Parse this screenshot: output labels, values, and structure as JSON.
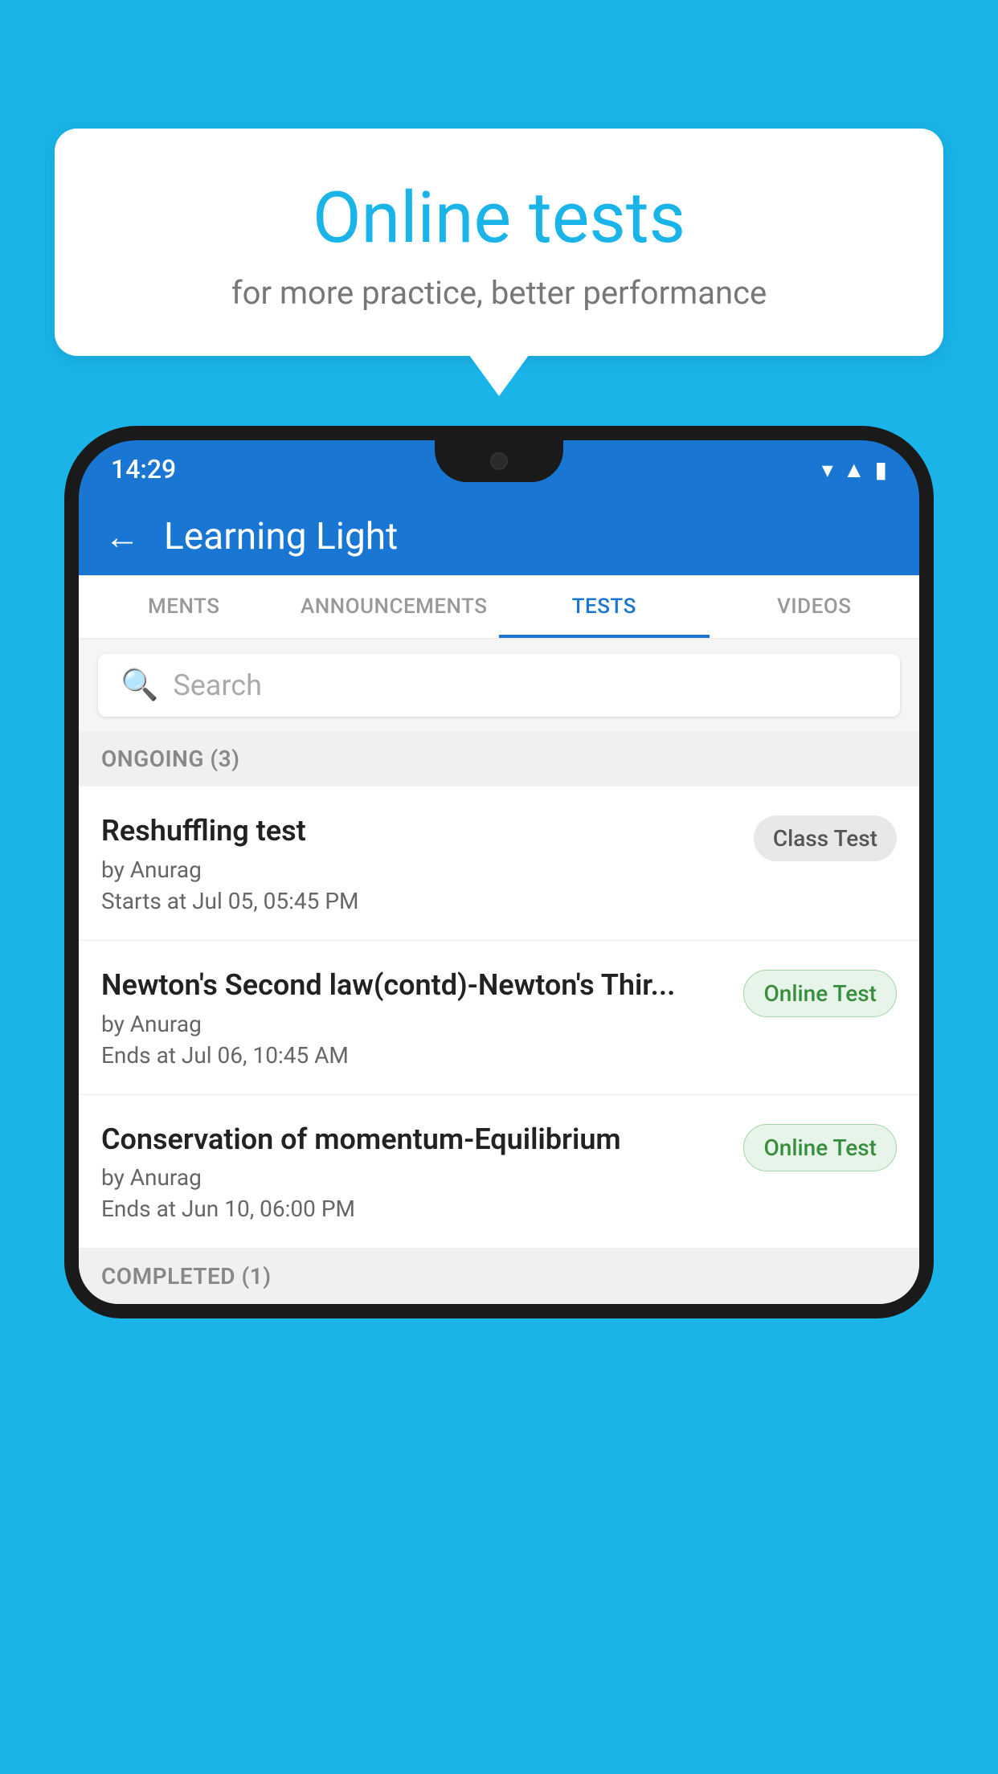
{
  "background_color": "#1ab4e8",
  "speech_bubble": {
    "title": "Online tests",
    "subtitle": "for more practice, better performance"
  },
  "phone": {
    "status_bar": {
      "time": "14:29",
      "icons": [
        "wifi",
        "signal",
        "battery"
      ]
    },
    "app_header": {
      "back_label": "←",
      "title": "Learning Light"
    },
    "tabs": [
      {
        "label": "MENTS",
        "active": false
      },
      {
        "label": "ANNOUNCEMENTS",
        "active": false
      },
      {
        "label": "TESTS",
        "active": true
      },
      {
        "label": "VIDEOS",
        "active": false
      }
    ],
    "search": {
      "placeholder": "Search"
    },
    "ongoing_section": {
      "label": "ONGOING (3)"
    },
    "tests": [
      {
        "name": "Reshuffling test",
        "author": "by Anurag",
        "date_label": "Starts at",
        "date": "Jul 05, 05:45 PM",
        "badge": "Class Test",
        "badge_type": "class"
      },
      {
        "name": "Newton's Second law(contd)-Newton's Thir...",
        "author": "by Anurag",
        "date_label": "Ends at",
        "date": "Jul 06, 10:45 AM",
        "badge": "Online Test",
        "badge_type": "online"
      },
      {
        "name": "Conservation of momentum-Equilibrium",
        "author": "by Anurag",
        "date_label": "Ends at",
        "date": "Jun 10, 06:00 PM",
        "badge": "Online Test",
        "badge_type": "online"
      }
    ],
    "completed_section": {
      "label": "COMPLETED (1)"
    }
  }
}
